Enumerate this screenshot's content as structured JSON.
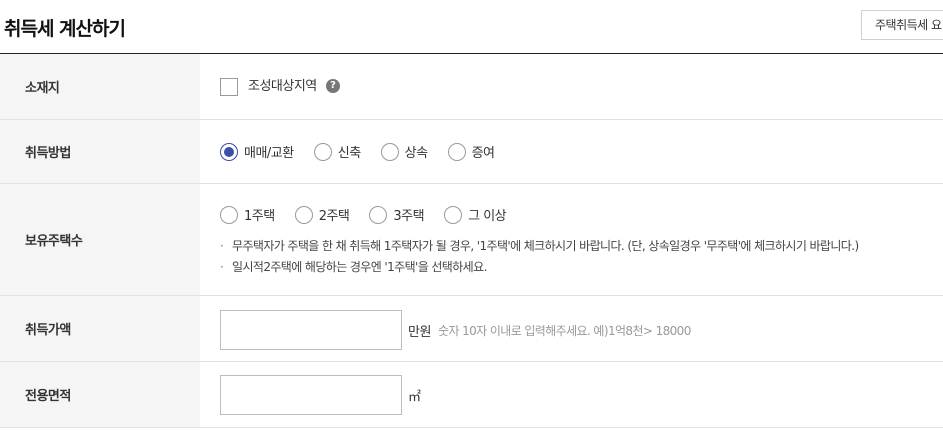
{
  "header": {
    "title": "취득세 계산하기",
    "side_button_label": "주택취득세 요"
  },
  "rows": {
    "location": {
      "label": "소재지",
      "checkbox_label": "조성대상지역",
      "checkbox_checked": false,
      "help_icon": "question-circle-icon"
    },
    "method": {
      "label": "취득방법",
      "options": [
        "매매/교환",
        "신축",
        "상속",
        "증여"
      ],
      "selected": "매매/교환"
    },
    "houses": {
      "label": "보유주택수",
      "options": [
        "1주택",
        "2주택",
        "3주택",
        "그 이상"
      ],
      "selected": null,
      "notes": [
        "무주택자가 주택을 한 채 취득해 1주택자가 될 경우, '1주택'에 체크하시기 바랍니다. (단, 상속일경우 '무주택'에 체크하시기 바랍니다.)",
        "일시적2주택에 해당하는 경우엔 '1주택'을 선택하세요."
      ]
    },
    "price": {
      "label": "취득가액",
      "value": "",
      "unit": "만원",
      "hint": "숫자 10자 이내로 입력해주세요. 예)1억8천> 18000"
    },
    "area": {
      "label": "전용면적",
      "value": "",
      "unit": "㎡"
    }
  },
  "colors": {
    "accent": "#3c4eaa",
    "label_background": "#f5f5f5",
    "divider": "#e2e2e2"
  }
}
